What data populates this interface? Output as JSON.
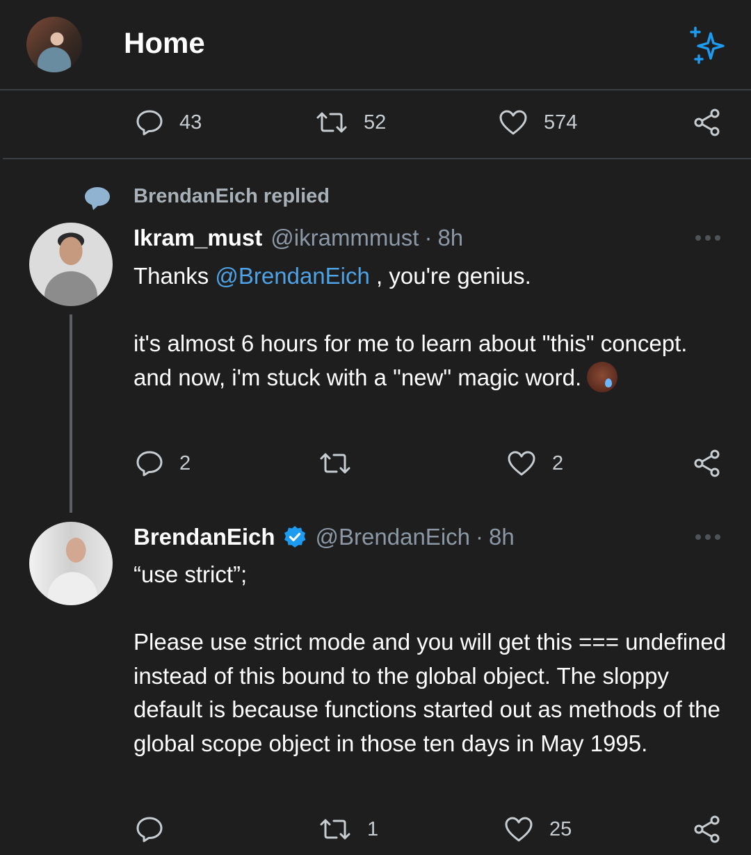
{
  "header": {
    "title": "Home"
  },
  "top_tweet_actions": {
    "replies": "43",
    "retweets": "52",
    "likes": "574"
  },
  "reply_context": {
    "text": "BrendanEich replied"
  },
  "tweet1": {
    "name": "Ikram_must",
    "handle": "@ikrammmust",
    "separator": "·",
    "time": "8h",
    "text_before_mention": "Thanks ",
    "mention": "@BrendanEich",
    "text_after_mention": " , you're genius.",
    "paragraph2": "it's almost 6 hours for me to learn about \"this\" concept.",
    "paragraph3": "and now, i'm stuck with a \"new\" magic word.",
    "emoji": "sweat-smile-emoji",
    "actions": {
      "replies": "2",
      "retweets": "",
      "likes": "2"
    }
  },
  "tweet2": {
    "name": "BrendanEich",
    "verified": true,
    "handle": "@BrendanEich",
    "separator": "·",
    "time": "8h",
    "line1": "“use strict”;",
    "paragraph2": "Please use strict mode and you will get this === undefined instead of this bound to the global object. The sloppy default is because functions started out as methods of the global scope object in those ten days in May 1995.",
    "actions": {
      "replies": "",
      "retweets": "1",
      "likes": "25"
    }
  },
  "colors": {
    "background": "#1e1e1e",
    "accent": "#1d9bf0",
    "mention": "#4da3e6",
    "muted": "#8b98a5"
  }
}
